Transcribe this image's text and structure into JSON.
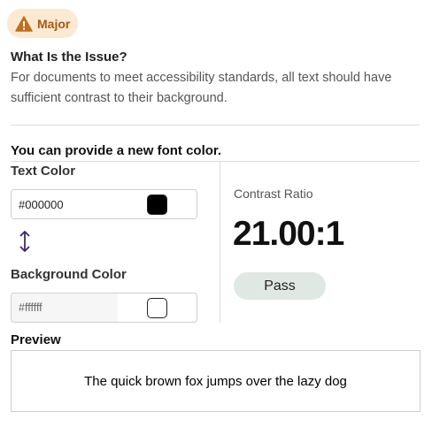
{
  "severity": {
    "label": "Major",
    "icon": "warning-triangle-icon",
    "color": "#c0711d",
    "background": "#fbe9d3"
  },
  "issue": {
    "title": "What Is the Issue?",
    "description": "For documents to meet accessibility standards, all text should have sufficient contrast to their background."
  },
  "fix": {
    "title": "You can provide a new font color.",
    "text_color": {
      "label": "Text Color",
      "value": "#000000",
      "swatch": "#000000"
    },
    "swap_icon": "swap-vertical-arrow-icon",
    "background_color": {
      "label": "Background Color",
      "value": "#ffffff",
      "swatch": "#ffffff"
    }
  },
  "contrast": {
    "label": "Contrast Ratio",
    "value": "21.00:1",
    "status": "Pass",
    "status_color": "#dfe8e2"
  },
  "preview": {
    "label": "Preview",
    "text": "The quick brown fox jumps over the lazy dog"
  }
}
